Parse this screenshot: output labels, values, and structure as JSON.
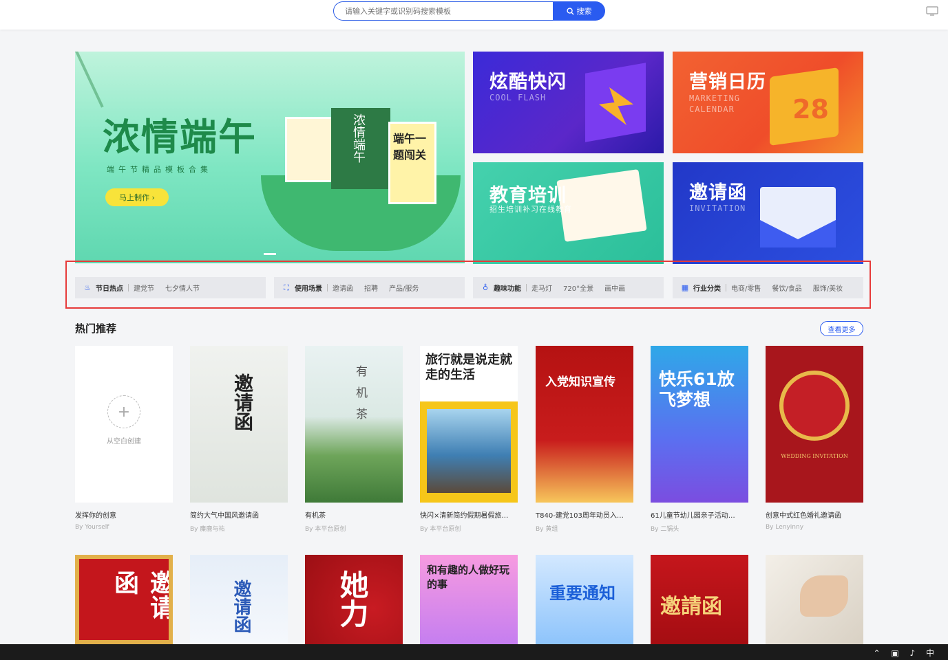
{
  "search": {
    "placeholder": "请输入关键字或识别码搜索模板",
    "button_label": "搜索"
  },
  "hero": {
    "title": "浓情端午",
    "subtitle": "端午节精品模板合集",
    "cta": "马上制作",
    "card_middle": "浓情端午",
    "card_right": "端午一题闯关"
  },
  "tiles": [
    {
      "title": "炫酷快闪",
      "subtitle": "COOL FLASH"
    },
    {
      "title": "营销日历",
      "subtitle": "MARKETING CALENDAR",
      "day": "28"
    },
    {
      "title": "教育培训",
      "subtitle": "招生培训补习在线教育"
    },
    {
      "title": "邀请函",
      "subtitle": "INVITATION"
    }
  ],
  "categories": [
    {
      "head": "节日热点",
      "icon": "flame-icon",
      "items": [
        "建党节",
        "七夕情人节"
      ]
    },
    {
      "head": "使用场景",
      "icon": "scan-icon",
      "items": [
        "邀请函",
        "招聘",
        "产品/服务"
      ]
    },
    {
      "head": "趣味功能",
      "icon": "bulb-icon",
      "items": [
        "走马灯",
        "720°全景",
        "画中画"
      ]
    },
    {
      "head": "行业分类",
      "icon": "grid-icon",
      "items": [
        "电商/零售",
        "餐饮/食品",
        "服饰/美妆"
      ]
    }
  ],
  "hot": {
    "title": "热门推荐",
    "more": "查看更多",
    "blank_label": "从空白创建",
    "cards": [
      {
        "name": "发挥你的创意",
        "author": "By Yourself"
      },
      {
        "name": "简约大气中国风邀请函",
        "author": "By 麋鹿与祐",
        "thumb_text": "邀请函"
      },
      {
        "name": "有机茶",
        "author": "By 本平台原创",
        "thumb_text": "有机茶"
      },
      {
        "name": "快闪×清新简约假期暑假旅…",
        "author": "By 本平台原创",
        "thumb_text": "旅行就是说走就走的生活"
      },
      {
        "name": "T840-建党103周年动员入…",
        "author": "By 黄组",
        "thumb_text": "入党知识宣传"
      },
      {
        "name": "61儿童节幼儿园亲子活动…",
        "author": "By 二锅头",
        "thumb_text": "快乐61放飞梦想"
      },
      {
        "name": "创意中式红色婚礼邀请函",
        "author": "By Lenyinny",
        "thumb_text": "WEDDING INVITATION"
      }
    ],
    "row2": [
      "邀请函",
      "邀请函",
      "她力",
      "和有趣的人做好玩的事",
      "重要通知",
      "邀請函",
      ""
    ]
  },
  "colors": {
    "accent": "#2a5bf0",
    "highlight_frame": "#e63a3a"
  }
}
